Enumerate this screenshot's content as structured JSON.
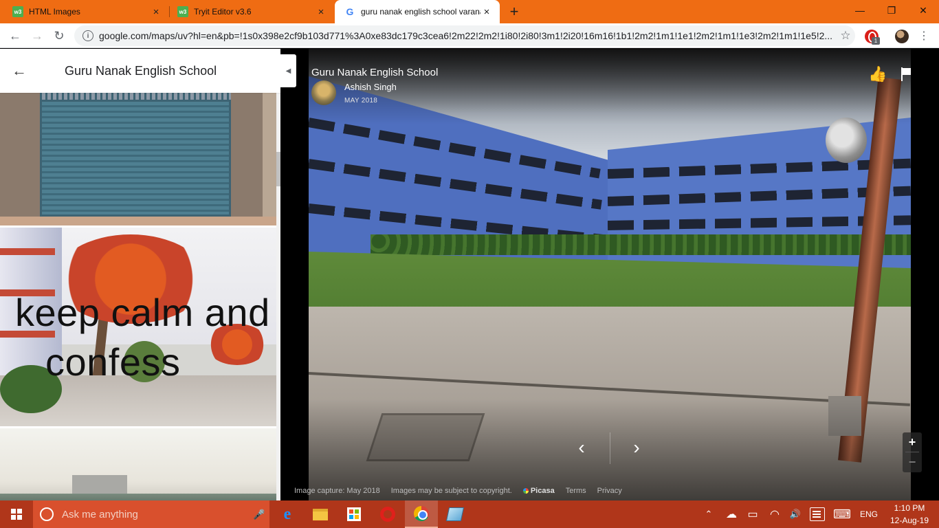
{
  "browser": {
    "tabs": [
      {
        "title": "HTML Images",
        "favicon_text": "w3",
        "close": "×"
      },
      {
        "title": "Tryit Editor v3.6",
        "favicon_text": "w3",
        "close": "×"
      },
      {
        "title": "guru nanak english school varanasi",
        "favicon_text": "G",
        "close": "×"
      }
    ],
    "new_tab": "+",
    "window_controls": {
      "minimize": "—",
      "restore": "❐",
      "close": "✕"
    },
    "url": "google.com/maps/uv?hl=en&pb=!1s0x398e2cf9b103d771%3A0xe83dc179c3cea6!2m22!2m2!1i80!2i80!3m1!2i20!16m16!1b1!2m2!1m1!1e1!2m2!1m1!1e3!2m2!1m1!1e5!2...",
    "extension_badge": "1",
    "icons": {
      "back": "←",
      "forward": "→",
      "reload": "↻",
      "info": "i",
      "star": "☆",
      "menu": "⋮"
    }
  },
  "left_panel": {
    "back_arrow": "←",
    "title": "Guru Nanak English School",
    "overlay_text_line1": "keep calm and",
    "overlay_text_line2": "confess"
  },
  "viewer": {
    "collapse_arrow": "◀",
    "place_name": "Guru Nanak English School",
    "author": "Ashish Singh",
    "date": "MAY 2018",
    "like_icon": "👍",
    "prev": "‹",
    "next": "›",
    "zoom_in": "+",
    "zoom_out": "−",
    "footer": {
      "capture": "Image capture: May 2018",
      "copyright": "Images may be subject to copyright.",
      "picasa": "Picasa",
      "terms": "Terms",
      "privacy": "Privacy"
    }
  },
  "taskbar": {
    "search_placeholder": "Ask me anything",
    "mic": "🎤",
    "tray": {
      "chevron": "⌃",
      "cloud": "☁",
      "battery": "▭",
      "wifi": "◠",
      "volume": "🔊",
      "keyboard": "⌨",
      "language": "ENG"
    },
    "time": "1:10 PM",
    "date": "12-Aug-19"
  }
}
